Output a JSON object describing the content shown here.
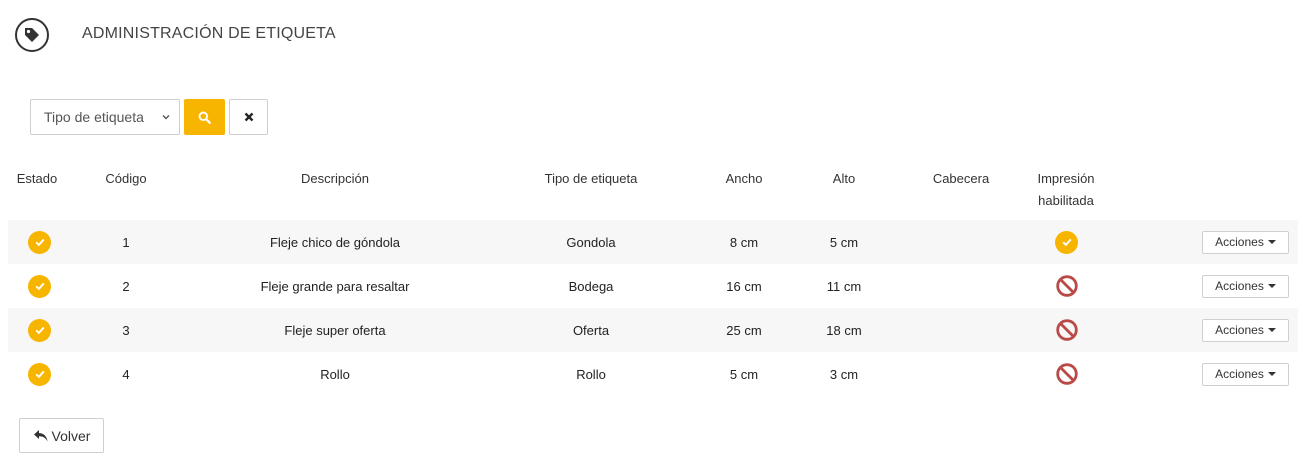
{
  "header": {
    "title": "ADMINISTRACIÓN DE ETIQUETA",
    "icon": "tag-icon"
  },
  "filters": {
    "select_value": "Tipo de etiqueta",
    "search_icon": "search-icon",
    "clear_icon": "close-icon"
  },
  "accent_color": "#f7b500",
  "danger_color": "#b94a48",
  "table": {
    "headers": {
      "estado": "Estado",
      "codigo": "Código",
      "descripcion": "Descripción",
      "tipo": "Tipo de etiqueta",
      "ancho": "Ancho",
      "alto": "Alto",
      "cabecera": "Cabecera",
      "impresion_1": "Impresión",
      "impresion_2": "habilitada"
    },
    "rows": [
      {
        "estado": "check",
        "codigo": "1",
        "descripcion": "Fleje chico de góndola",
        "tipo": "Gondola",
        "ancho": "8 cm",
        "alto": "5 cm",
        "cabecera": "",
        "impresion": "check",
        "acciones": "Acciones"
      },
      {
        "estado": "check",
        "codigo": "2",
        "descripcion": "Fleje grande para resaltar",
        "tipo": "Bodega",
        "ancho": "16 cm",
        "alto": "11 cm",
        "cabecera": "",
        "impresion": "ban",
        "acciones": "Acciones"
      },
      {
        "estado": "check",
        "codigo": "3",
        "descripcion": "Fleje super oferta",
        "tipo": "Oferta",
        "ancho": "25 cm",
        "alto": "18 cm",
        "cabecera": "",
        "impresion": "ban",
        "acciones": "Acciones"
      },
      {
        "estado": "check",
        "codigo": "4",
        "descripcion": "Rollo",
        "tipo": "Rollo",
        "ancho": "5 cm",
        "alto": "3 cm",
        "cabecera": "",
        "impresion": "ban",
        "acciones": "Acciones"
      }
    ]
  },
  "footer": {
    "back_label": "Volver",
    "back_icon": "reply-icon"
  }
}
